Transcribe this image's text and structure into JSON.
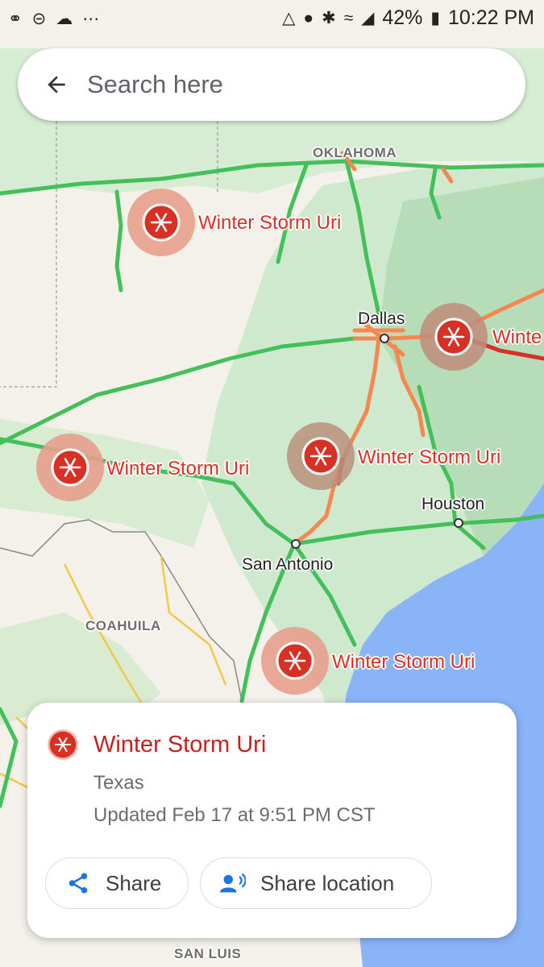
{
  "status_bar": {
    "left_icons": [
      "voicemail-icon",
      "do-not-disturb-icon",
      "cloud-icon",
      "more-dots-icon"
    ],
    "right_icons": [
      "data-saver-icon",
      "location-icon",
      "bluetooth-icon",
      "wifi-icon",
      "signal-icon",
      "battery-icon"
    ],
    "battery": "42%",
    "time": "10:22 PM"
  },
  "search": {
    "placeholder": "Search here"
  },
  "map": {
    "region_labels": {
      "oklahoma": "OKLAHOMA",
      "coahuila": "COAHUILA",
      "san_luis": "SAN LUIS"
    },
    "cities": {
      "dallas": "Dallas",
      "houston": "Houston",
      "san_antonio": "San Antonio"
    },
    "storm_markers": {
      "panhandle": "Winter Storm Uri",
      "west": "Winter Storm Uri",
      "central": "Winter Storm Uri",
      "south": "Winter Storm Uri",
      "east_truncated": "Winte"
    },
    "colors": {
      "storm_red": "#d93025",
      "traffic_green": "#43c05a",
      "traffic_orange": "#f5874f",
      "traffic_red": "#d93025",
      "water": "#8ab4f8",
      "land_green": "#c7e6c7"
    }
  },
  "card": {
    "title": "Winter Storm Uri",
    "location": "Texas",
    "updated": "Updated Feb 17 at 9:51 PM CST",
    "share_label": "Share",
    "share_location_label": "Share location"
  }
}
